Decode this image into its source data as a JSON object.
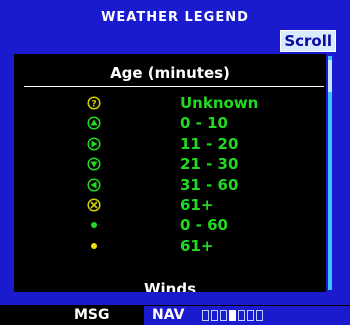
{
  "window": {
    "title": "WEATHER LEGEND"
  },
  "scroll_button": {
    "label": "Scroll"
  },
  "legend": {
    "header": "Age (minutes)",
    "rows": [
      {
        "icon": "question-circle-icon",
        "label": "Unknown",
        "color": "#22d922",
        "icon_color": "#d0d000"
      },
      {
        "icon": "arrow-up-circle-icon",
        "label": "0 - 10",
        "color": "#22d922",
        "icon_color": "#22d922"
      },
      {
        "icon": "arrow-right-circle-icon",
        "label": "11 - 20",
        "color": "#22d922",
        "icon_color": "#22d922"
      },
      {
        "icon": "arrow-down-circle-icon",
        "label": "21 - 30",
        "color": "#22d922",
        "icon_color": "#22d922"
      },
      {
        "icon": "arrow-left-circle-icon",
        "label": "31 - 60",
        "color": "#22d922",
        "icon_color": "#22d922"
      },
      {
        "icon": "x-circle-icon",
        "label": "61+",
        "color": "#22d922",
        "icon_color": "#d0d000"
      },
      {
        "icon": "green-dot-icon",
        "label": "0 - 60",
        "color": "#22d922",
        "icon_color": "#22d922"
      },
      {
        "icon": "yellow-dot-icon",
        "label": "61+",
        "color": "#22d922",
        "icon_color": "#f0e000"
      }
    ],
    "next_section": "Winds"
  },
  "status_bar": {
    "msg": "MSG",
    "nav": "NAV",
    "nav_segments": 7,
    "nav_active_index": 3
  }
}
